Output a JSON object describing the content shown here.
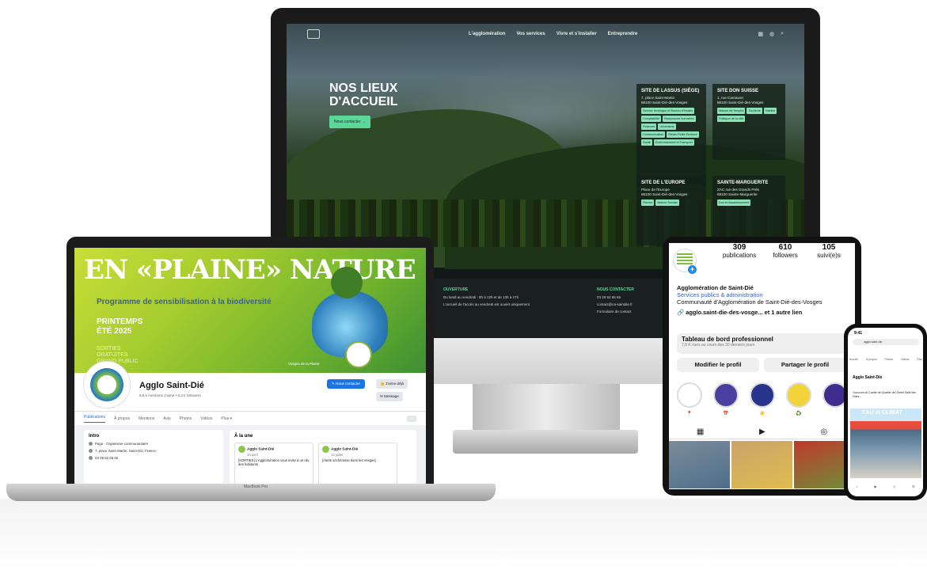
{
  "website": {
    "nav": [
      "L'agglomération",
      "Vos services",
      "Vivre et s'installer",
      "Entreprendre"
    ],
    "nav_icons": [
      "calendar-icon",
      "accessibility-icon",
      "search-icon"
    ],
    "hero_title": "NOS LIEUX D'ACCUEIL",
    "hero_button": "Nous contacter →",
    "sites": [
      {
        "title": "SITE DE LASSUS (SIÈGE)",
        "lines": [
          "7, place Saint-Martin",
          "88100 Saint-Dié-des-Vosges"
        ],
        "tags": [
          "Service technique et Bureau d'études",
          "Comptabilité",
          "Ressources humaines",
          "Finances",
          "Urbanisme",
          "Communication",
          "Relais Petite Enfance",
          "Santé",
          "Environnement et Transport"
        ]
      },
      {
        "title": "SITE DON SUISSE",
        "lines": [
          "1, rue Carnavon",
          "88100 Saint-Dié-des-Vosges"
        ],
        "tags": [
          "Maison de l'emploi",
          "Tourisme",
          "Habitat",
          "Politique de la ville"
        ]
      },
      {
        "title": "SITE DE L'EUROPE",
        "lines": [
          "Place de l'Europe",
          "88100 Saint-Dié-des-Vosges"
        ],
        "tags": [
          "Piscine",
          "Maison Sociale"
        ]
      },
      {
        "title": "SAINTE-MARGUERITE",
        "lines": [
          "ZAC rue des Grands Prés",
          "88100 Sainte-Marguerite"
        ],
        "tags": [
          "Eau et Assainissement"
        ]
      }
    ],
    "footer_col1_head": "OUVERTURE",
    "footer_col1_lines": [
      "Du lundi au vendredi : 8h à 12h et de 13h à 17h",
      "L'accueil de l'accès au vendredi est ouvert uniquement"
    ],
    "footer_col2_head": "NOUS CONTACTER",
    "footer_col2_lines": [
      "03 29 52 65 65",
      "contact@ca-saintdie.fr",
      "Formulaire de contact"
    ]
  },
  "facebook": {
    "cover_title": "EN «PLAINE» NATURE !",
    "cover_subtitle": "Programme de sensibilisation à la biodiversité",
    "cover_season": "PRINTEMPS",
    "cover_year": "ÉTÉ 2025",
    "cover_soft": "SORTIES GRATUITES GRAND PUBLIC",
    "cover_credit": "Vosges de la Plaine",
    "page_name": "Agglo Saint-Dié",
    "page_stats": "5,9 k mentions J'aime • 6,2 k followers",
    "btn_contact": "✎ Nous contacter",
    "btn_like": "👍 J'aime déjà",
    "btn_message": "✉ Message",
    "tabs": [
      "Publications",
      "À propos",
      "Mentions",
      "Avis",
      "Photos",
      "Vidéos",
      "Plus ▾"
    ],
    "intro_heading": "Intro",
    "intro_rows": [
      "Page · Organisme communautaire",
      "7, place Saint-Martin, Saint-Dié, France",
      "03 29 52 65 65"
    ],
    "une_heading": "À la une",
    "posts": [
      {
        "author": "Agglo Saint-Dié",
        "date": "10 avril",
        "text": "[SORTIES] L'Agglomération vous invite à un rdv des habitants"
      },
      {
        "author": "Agglo Saint-Dié",
        "date": "12 juillet",
        "text": "[Alerte sécheresse dans les Vosges]"
      }
    ],
    "laptop_brand": "MacBook Pro"
  },
  "instagram": {
    "posts_count": "309",
    "posts_label": "publications",
    "followers_count": "610",
    "followers_label": "followers",
    "following_count": "105",
    "following_label": "suivi(e)s",
    "name": "Agglomération de Saint-Dié",
    "category": "Services publics & administration",
    "description": "Communauté d'Agglomération de Saint-Dié-des-Vosges",
    "link": "🔗 agglo.saint-die-des-vosge... et 1 autre lien",
    "dashboard_title": "Tableau de bord professionnel",
    "dashboard_sub": "7,8 K vues au cours des 30 derniers jours",
    "btn_edit": "Modifier le profil",
    "btn_share": "Partager le profil",
    "highlight_icons": [
      "📍",
      "📅",
      "☀️",
      "♻️"
    ],
    "tab_icons": [
      "▦",
      "▶",
      "◎"
    ],
    "grid_colors": [
      "#7a8c9a",
      "#c9a46b",
      "#c0392b",
      "#4f6e8b",
      "#e0bc4e",
      "#6e8f3a"
    ]
  },
  "phone": {
    "time": "9:41",
    "url": "agglo.saint-die",
    "tabs": [
      "Accueil",
      "À propos",
      "Photos",
      "Vidéos",
      "Plus"
    ],
    "name": "Agglo Saint-Dié",
    "text": "Concours du Comité de Quartier de l'Orient Salle des Fêtes...",
    "banner": "EAU et CLIMAT",
    "nav": [
      "⌂",
      "▶",
      "◇",
      "☰"
    ]
  }
}
